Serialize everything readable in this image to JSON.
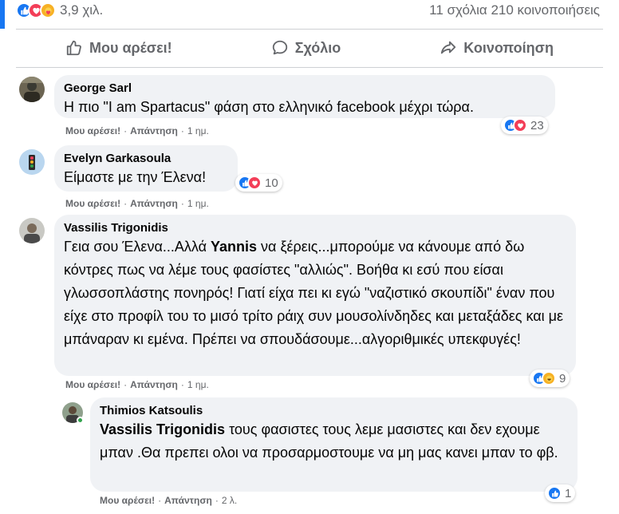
{
  "summary": {
    "reaction_count": "3,9 χιλ.",
    "comments_shares": "11 σχόλια 210 κοινοποιήσεις"
  },
  "actions": {
    "like": "Μου αρέσει!",
    "comment": "Σχόλιο",
    "share": "Κοινοποίηση"
  },
  "comments": [
    {
      "author": "George Sarl",
      "text": "Η πιο \"I am Spartacus\" φάση στο ελληνικό facebook μέχρι τώρα.",
      "like": "Μου αρέσει!",
      "reply": "Απάντηση",
      "time": "1 ημ.",
      "reactions": "23"
    },
    {
      "author": "Evelyn Garkasoula",
      "text": "Είμαστε με την Έλενα!",
      "like": "Μου αρέσει!",
      "reply": "Απάντηση",
      "time": "1 ημ.",
      "reactions": "10"
    },
    {
      "author": "Vassilis Trigonidis",
      "text_before": "Γεια σου Έλενα...Αλλά ",
      "mention": "Yannis",
      "text_after": " να ξέρεις...μπορούμε να κάνουμε από δω κόντρες πως να λέμε τους φασίστες \"αλλιώς\". Βοήθα κι εσύ που είσαι γλωσσοπλάστης πονηρός! Γιατί είχα πει κι εγώ \"ναζιστικό σκουπίδι\" έναν που είχε στο προφίλ του το μισό τρίτο ράιχ συν μουσολίνδηδες και μεταξάδες και με μπάναραν κι εμένα. Πρέπει να σπουδάσουμε...αλγοριθμικές υπεκφυγές!",
      "like": "Μου αρέσει!",
      "reply": "Απάντηση",
      "time": "1 ημ.",
      "reactions": "9"
    },
    {
      "author": "Thimios Katsoulis",
      "mention": "Vassilis Trigonidis",
      "text_after": " τους φασιστες τους λεμε μασιστες και δεν εχουμε μπαν .Θα πρεπει ολοι να προσαρμοστουμε να μη μας κανει μπαν το φβ.",
      "like": "Μου αρέσει!",
      "reply": "Απάντηση",
      "time": "2 λ.",
      "reactions": "1"
    }
  ],
  "colors": {
    "accent": "#1877f2",
    "bubble": "#f0f2f5",
    "meta": "#65676b",
    "love": "#f33e58",
    "haha": "#f7b125",
    "online": "#31a24c"
  },
  "icons": [
    "like-icon",
    "love-icon",
    "care-icon",
    "haha-icon",
    "comment-icon",
    "share-icon"
  ]
}
